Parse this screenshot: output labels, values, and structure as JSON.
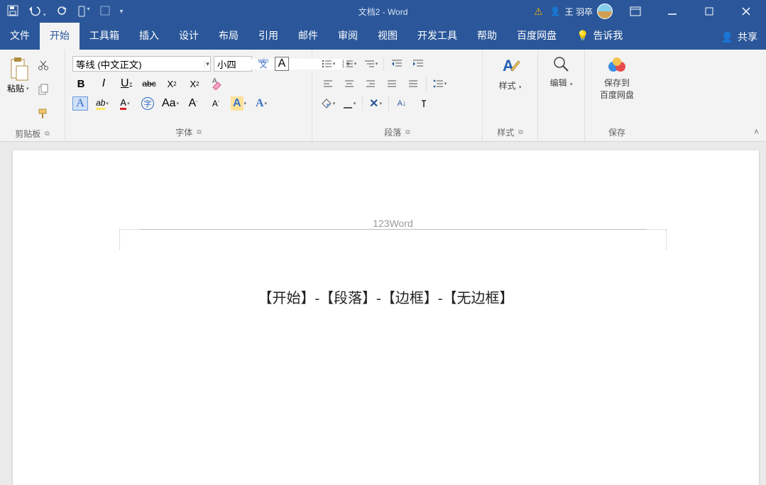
{
  "titlebar": {
    "doc_title": "文档2 - Word",
    "username": "王 羽卒"
  },
  "menu": {
    "file": "文件",
    "home": "开始",
    "toolbox": "工具箱",
    "insert": "插入",
    "design": "设计",
    "layout": "布局",
    "ref": "引用",
    "mail": "邮件",
    "review": "审阅",
    "view": "视图",
    "dev": "开发工具",
    "help": "帮助",
    "baidu": "百度网盘",
    "tellme": "告诉我",
    "share": "共享"
  },
  "ribbon": {
    "clipboard": {
      "paste": "粘贴",
      "label": "剪贴板"
    },
    "font": {
      "name": "等线 (中文正文)",
      "size": "小四",
      "label": "字体",
      "bold": "B",
      "italic": "I",
      "underline": "U",
      "strike": "abc",
      "sub": "X",
      "sup": "X",
      "pinyin": "wén",
      "charborder": "A",
      "highlight": "ab",
      "fontcolor": "A",
      "circled": "字",
      "case": "Aa",
      "grow": "A",
      "shrink": "A",
      "texteffect": "A",
      "clear": "A"
    },
    "para": {
      "label": "段落"
    },
    "styles": {
      "big": "样式",
      "label": "样式"
    },
    "edit": {
      "big": "编辑"
    },
    "save": {
      "line1": "保存到",
      "line2": "百度网盘",
      "label": "保存"
    }
  },
  "doc": {
    "header": "123Word",
    "body": "【开始】-【段落】-【边框】-【无边框】"
  }
}
